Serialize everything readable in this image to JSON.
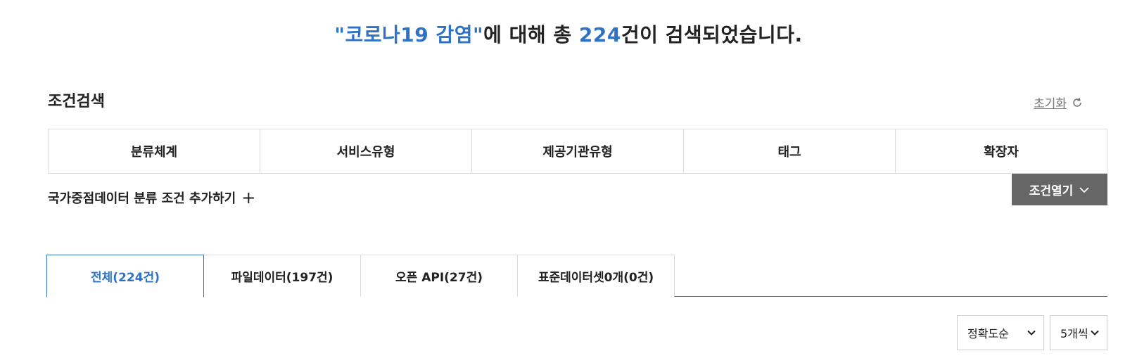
{
  "headline": {
    "query": "\"코로나19 감염\"",
    "mid": "에 대해 총 ",
    "count": "224",
    "tail": "건이 검색되었습니다."
  },
  "conditions": {
    "title": "조건검색",
    "reset_label": "초기화",
    "filters": [
      "분류체계",
      "서비스유형",
      "제공기관유형",
      "태그",
      "확장자"
    ],
    "add_label": "국가중점데이터 분류 조건 추가하기",
    "open_label": "조건열기"
  },
  "tabs": [
    {
      "label": "전체(224건)",
      "active": true
    },
    {
      "label": "파일데이터(197건)",
      "active": false
    },
    {
      "label": "오픈 API(27건)",
      "active": false
    },
    {
      "label": "표준데이터셋0개(0건)",
      "active": false
    }
  ],
  "sort": {
    "selected": "정확도순",
    "page_size": "5개씩"
  },
  "colors": {
    "accent": "#2d72c4",
    "button_bg": "#666666"
  }
}
